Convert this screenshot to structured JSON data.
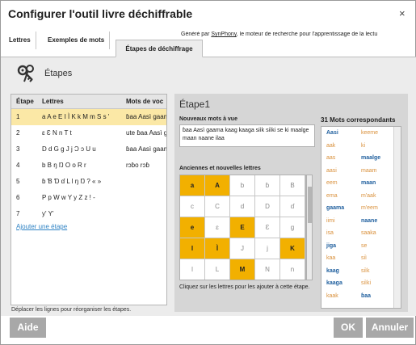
{
  "window": {
    "title": "Configurer l'outil livre déchiffrable",
    "close_glyph": "×"
  },
  "tabs": [
    {
      "label": "Lettres"
    },
    {
      "label": "Exemples de mots"
    },
    {
      "label": "Étapes de déchiffrage"
    }
  ],
  "credit": {
    "prefix": "Généré par ",
    "link": "SynPhony",
    "suffix": ", le moteur de recherche pour l'apprentissage de la lectu"
  },
  "steps": {
    "heading": "Étapes",
    "icon": "keys-icon",
    "columns": [
      "Étape",
      "Lettres",
      "Mots de voc"
    ],
    "rows": [
      {
        "num": "1",
        "letters": "a A e E I Ì K k M m S s '",
        "words": "ɓaa Aasì gaam"
      },
      {
        "num": "2",
        "letters": "ɛ Ɛ N n T t",
        "words": "ute ɓaa Aasì g"
      },
      {
        "num": "3",
        "letters": "D d G g J j Ɔ ɔ U u",
        "words": "ɓaa Aasì gaam"
      },
      {
        "num": "4",
        "letters": "b B ŋ Ŋ O o R r",
        "words": "rɔɓo rɔɓ"
      },
      {
        "num": "5",
        "letters": "ɓ Ɓ Ɗ ɗ L l ŋ Ŋ ? « »",
        "words": ""
      },
      {
        "num": "6",
        "letters": "P p W w Y y Z z ! -",
        "words": ""
      },
      {
        "num": "7",
        "letters": "y' Y'",
        "words": ""
      }
    ],
    "add_link": "Ajouter une étape",
    "reorder_hint": "Déplacer les lignes pour réorganiser les étapes."
  },
  "step_panel": {
    "title": "Étape1",
    "new_words_label": "Nouveaux mots à vue",
    "new_words": "ɓaa Aasì gaama kaag kaaga siìk siìki se ki maalge maan naane ilaa",
    "letters_label": "Anciennes et nouvelles lettres",
    "letters": [
      [
        "a",
        "A",
        "b",
        "ɓ",
        "B"
      ],
      [
        "c",
        "C",
        "d",
        "D",
        "ɗ"
      ],
      [
        "e",
        "ɛ",
        "E",
        "Ɛ",
        "g"
      ],
      [
        "I",
        "Ì",
        "J",
        "j",
        "K"
      ],
      [
        "l",
        "L",
        "M",
        "N",
        "n"
      ]
    ],
    "letter_states": [
      [
        true,
        true,
        false,
        false,
        false
      ],
      [
        false,
        false,
        false,
        false,
        false
      ],
      [
        true,
        false,
        true,
        false,
        false
      ],
      [
        true,
        true,
        false,
        false,
        true
      ],
      [
        false,
        false,
        true,
        false,
        false
      ]
    ],
    "letters_hint": "Cliquez sur les lettres pour les ajouter à cette étape.",
    "matches_label": "31 Mots correspondants",
    "matches": [
      {
        "a": "Aasi",
        "a_style": "bold",
        "b": "keeme",
        "b_style": "pale"
      },
      {
        "a": "aak",
        "a_style": "pale",
        "b": "ki",
        "b_style": "pale"
      },
      {
        "a": "aas",
        "a_style": "pale",
        "b": "maalge",
        "b_style": "bold"
      },
      {
        "a": "aasi",
        "a_style": "pale",
        "b": "maam",
        "b_style": "pale"
      },
      {
        "a": "eem",
        "a_style": "pale",
        "b": "maan",
        "b_style": "bold"
      },
      {
        "a": "ema",
        "a_style": "pale",
        "b": "m'aak",
        "b_style": "pale"
      },
      {
        "a": "gaama",
        "a_style": "bold",
        "b": "m'eem",
        "b_style": "pale"
      },
      {
        "a": "iimi",
        "a_style": "pale",
        "b": "naane",
        "b_style": "bold"
      },
      {
        "a": "isa",
        "a_style": "pale",
        "b": "saaka",
        "b_style": "pale"
      },
      {
        "a": "jiga",
        "a_style": "bold",
        "b": "se",
        "b_style": "pale"
      },
      {
        "a": "kaa",
        "a_style": "pale",
        "b": "siì",
        "b_style": "pale"
      },
      {
        "a": "kaag",
        "a_style": "bold",
        "b": "siìk",
        "b_style": "pale"
      },
      {
        "a": "kaaga",
        "a_style": "bold",
        "b": "siìki",
        "b_style": "pale"
      },
      {
        "a": "kaak",
        "a_style": "pale",
        "b": "ɓaa",
        "b_style": "bold"
      }
    ]
  },
  "footer": {
    "help": "Aide",
    "ok": "OK",
    "cancel": "Annuler"
  }
}
